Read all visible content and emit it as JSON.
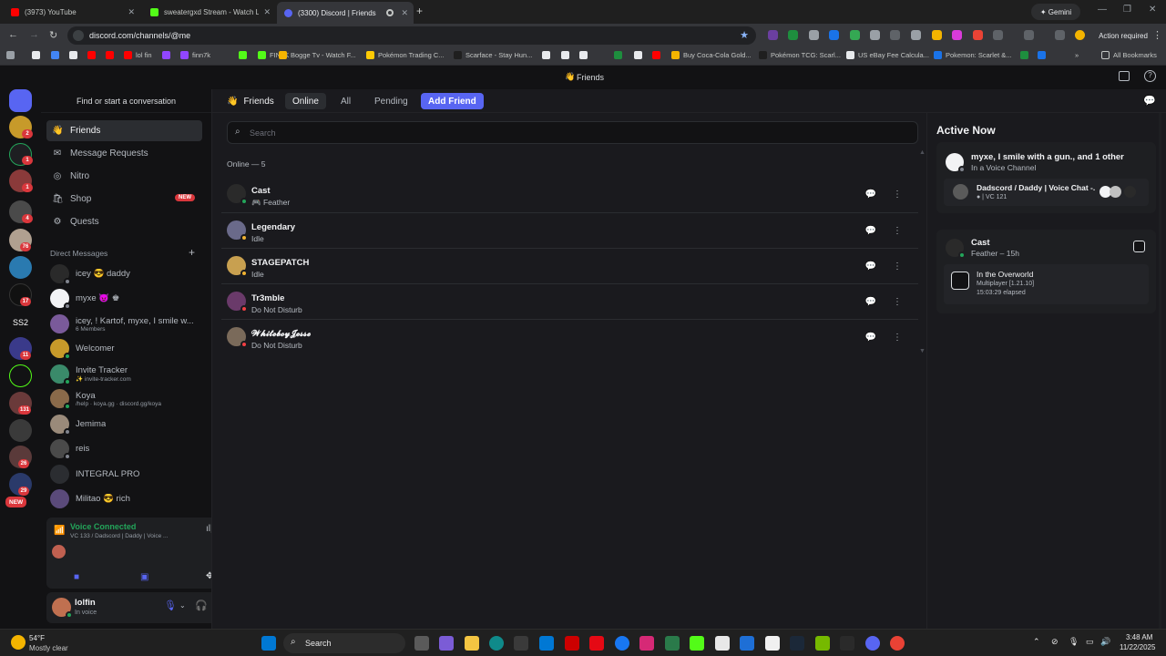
{
  "browser": {
    "tabs": [
      {
        "title": "(3973) YouTube",
        "color": "#ff0000",
        "active": false
      },
      {
        "title": "sweatergxd Stream - Watch Live",
        "color": "#53fc18",
        "active": false
      },
      {
        "title": "(3300) Discord | Friends",
        "color": "#5865f2",
        "active": true
      }
    ],
    "new_tab": "+",
    "gemini": "✦ Gemini",
    "url": "discord.com/channels/@me",
    "action_required": "Action required",
    "bookmarks": [
      {
        "label": "",
        "color": "#e8eaed"
      },
      {
        "label": "",
        "color": "#4285f4"
      },
      {
        "label": "",
        "color": "#e8eaed"
      },
      {
        "label": "",
        "color": "#ff0000"
      },
      {
        "label": "",
        "color": "#ff0000"
      },
      {
        "label": "lol fin",
        "color": "#ff0000"
      },
      {
        "label": "",
        "color": "#9146ff"
      },
      {
        "label": "finn7k",
        "color": "#9146ff"
      },
      {
        "label": "",
        "color": "#53fc18"
      },
      {
        "label": "FIN7K",
        "color": "#53fc18"
      },
      {
        "label": "Bogge Tv - Watch F...",
        "color": "#f4b400"
      },
      {
        "label": "Pokémon Trading C...",
        "color": "#ffcb05"
      },
      {
        "label": "Scarface - Stay Hun...",
        "color": "#1f1f1f"
      },
      {
        "label": "",
        "color": "#e8eaed"
      },
      {
        "label": "",
        "color": "#e8eaed"
      },
      {
        "label": "",
        "color": "#e8eaed"
      },
      {
        "label": "",
        "color": "#1e8e3e"
      },
      {
        "label": "",
        "color": "#e8eaed"
      },
      {
        "label": "",
        "color": "#ff0000"
      },
      {
        "label": "Buy Coca-Cola Gold...",
        "color": "#f4b400"
      },
      {
        "label": "Pokémon TCG: Scarl...",
        "color": "#1f1f1f"
      },
      {
        "label": "US eBay Fee Calcula...",
        "color": "#e8eaed"
      },
      {
        "label": "Pokemon: Scarlet &...",
        "color": "#1a73e8"
      },
      {
        "label": "",
        "color": "#1e8e3e"
      },
      {
        "label": "",
        "color": "#1a73e8"
      }
    ],
    "all_bookmarks": "All Bookmarks"
  },
  "discord": {
    "top_title": "Friends",
    "sidebar": {
      "search_label": "Find or start a conversation",
      "nav": [
        {
          "label": "Friends",
          "icon": "👋",
          "selected": true
        },
        {
          "label": "Message Requests",
          "icon": "✉",
          "selected": false
        },
        {
          "label": "Nitro",
          "icon": "◎",
          "selected": false
        },
        {
          "label": "Shop",
          "icon": "🛍",
          "selected": false,
          "badge": "NEW"
        },
        {
          "label": "Quests",
          "icon": "⚙",
          "selected": false
        }
      ],
      "dm_header": "Direct Messages",
      "dm_add": "+",
      "dms": [
        {
          "name": "icey 😎 daddy",
          "sub": "",
          "avatar": "#2a2a2a",
          "status": "#80848e"
        },
        {
          "name": "myxe 😈 ♚",
          "sub": "",
          "avatar": "#f2f3f5",
          "status": "#80848e"
        },
        {
          "name": "icey, ! Kartof, myxe, I smile w...",
          "sub": "6 Members",
          "avatar": "#7a5a9a",
          "status": ""
        },
        {
          "name": "Welcomer",
          "sub": "",
          "avatar": "#c79a2a",
          "status": "#23a55a"
        },
        {
          "name": "Invite Tracker",
          "sub": "✨ invite-tracker.com",
          "avatar": "#3a8a6a",
          "status": "#23a55a"
        },
        {
          "name": "Koya",
          "sub": "/help · koya.gg · discord.gg/koya",
          "avatar": "#8a6a4a",
          "status": "#23a55a"
        },
        {
          "name": "Jemima",
          "sub": "",
          "avatar": "#9a8a7a",
          "status": "#80848e"
        },
        {
          "name": "reis",
          "sub": "",
          "avatar": "#4a4a4a",
          "status": "#80848e"
        },
        {
          "name": "INTEGRAL PRO",
          "sub": "",
          "avatar": "#2b2d31",
          "status": ""
        },
        {
          "name": "Militao 😎 rich",
          "sub": "",
          "avatar": "#5a4a7a",
          "status": ""
        }
      ],
      "voice": {
        "status": "Voice Connected",
        "channel": "VC 133 / Dadscord | Daddy | Voice ..."
      },
      "user": {
        "name": "lolfin",
        "status": "In voice"
      }
    },
    "rail_badges": [
      "2",
      "1",
      "1",
      "4",
      "76",
      "17",
      "11",
      "131",
      "26",
      "29"
    ],
    "rail_labels": {
      "ss2": "SS2",
      "new": "NEW"
    },
    "header_tabs": [
      {
        "label": "Friends",
        "kind": "title"
      },
      {
        "label": "Online",
        "kind": "selected"
      },
      {
        "label": "All",
        "kind": "normal"
      },
      {
        "label": "Pending",
        "kind": "normal"
      },
      {
        "label": "Add Friend",
        "kind": "add"
      }
    ],
    "search_placeholder": "Search",
    "online_header": "Online — 5",
    "friends": [
      {
        "name": "Cast",
        "status": "🎮 Feather",
        "avatar": "#2a2a2a",
        "dot": "#23a55a"
      },
      {
        "name": "Legendary",
        "status": "Idle",
        "avatar": "#6a6a8a",
        "dot": "#f0b232"
      },
      {
        "name": "STAGEPATCH",
        "status": "Idle",
        "avatar": "#c8a050",
        "dot": "#f0b232"
      },
      {
        "name": "Tr3mble",
        "status": "Do Not Disturb",
        "avatar": "#6a3a6a",
        "dot": "#f23f43"
      },
      {
        "name": "𝓦𝓱𝓲𝓽𝓮𝓫𝓸𝔂𝓙𝓮𝓼𝓼𝓮",
        "status": "Do Not Disturb",
        "avatar": "#7a6a5a",
        "dot": "#f23f43"
      }
    ],
    "active_now": {
      "title": "Active Now",
      "card1": {
        "title": "myxe, I smile with a gun., and 1 other",
        "sub": "In a Voice Channel",
        "server": "Dadscord / Daddy | Voice Chat -...",
        "channel": "VC 121"
      },
      "card2": {
        "name": "Cast",
        "sub": "Feather – 15h",
        "game": "In the Overworld",
        "detail": "Multiplayer [1.21.10]",
        "elapsed": "15:03:29 elapsed"
      }
    }
  },
  "taskbar": {
    "weather_temp": "54°F",
    "weather_desc": "Mostly clear",
    "search": "Search",
    "time": "3:48 AM",
    "date": "11/22/2025"
  }
}
